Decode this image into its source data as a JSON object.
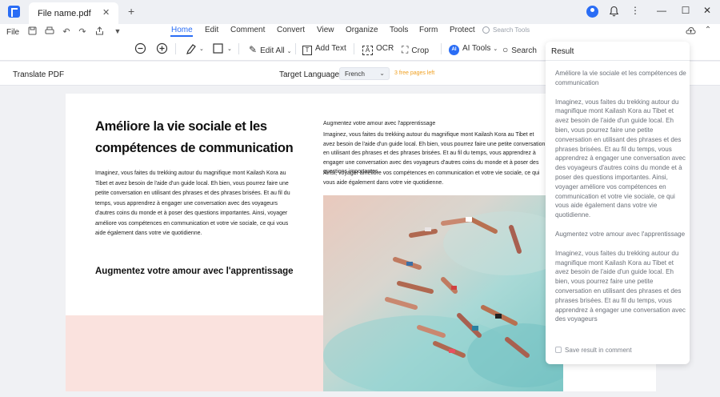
{
  "titlebar": {
    "tab_title": "File name.pdf",
    "tab_close": "✕",
    "new_tab": "+",
    "window_controls": [
      "⋮",
      "—",
      "☐",
      "✕"
    ]
  },
  "toolbar": {
    "file_menu": "File",
    "nav_tabs": [
      "Home",
      "Edit",
      "Comment",
      "Convert",
      "View",
      "Organize",
      "Tools",
      "Form",
      "Protect"
    ],
    "active_tab": "Home",
    "search_tools_placeholder": "Search Tools",
    "tools": {
      "edit_all": "Edit All",
      "add_text": "Add Text",
      "ocr": "OCR",
      "crop": "Crop",
      "ai_tools": "AI Tools",
      "ai_badge": "AI",
      "search": "Search"
    }
  },
  "translate": {
    "title": "Translate PDF",
    "target_language_label": "Target Language",
    "language": "French",
    "free_pages": "3 free pages left"
  },
  "document": {
    "heading": "Améliore la vie sociale et les compétences de communication",
    "body": "Imaginez, vous faites du trekking autour du magnifique mont Kailash Kora au Tibet et avez besoin de l'aide d'un guide local. Eh bien, vous pourrez faire une petite conversation en utilisant des phrases et des phrases brisées. Et au fil du temps, vous apprendrez à engager une conversation avec des voyageurs d'autres coins du monde et à poser des questions importantes. Ainsi, voyager améliore vos compétences en communication et votre vie sociale, ce qui vous aide également dans votre vie quotidienne.",
    "subheading": "Augmentez votre amour avec l'apprentissage",
    "col2_heading": "Augmentez votre amour avec l'apprentissage",
    "col2_p1": "Imaginez, vous faites du trekking autour du magnifique mont Kailash Kora au Tibet et avez besoin de l'aide d'un guide local. Eh bien, vous pourrez faire une petite conversation en utilisant des phrases et des phrases brisées. Et au fil du temps, vous apprendrez à engager une conversation avec des voyageurs d'autres coins du monde et à poser des questions importantes.",
    "col2_p2": "Ainsi, voyager améliore vos compétences en communication et votre vie sociale, ce qui vous aide également dans votre vie quotidienne."
  },
  "result": {
    "title": "Result",
    "paragraphs": [
      "Améliore la vie sociale et les compétences de communication",
      "Imaginez, vous faites du trekking autour du magnifique mont Kailash Kora au Tibet et avez besoin de l'aide d'un guide local. Eh bien, vous pourrez faire une petite conversation en utilisant des phrases et des phrases brisées. Et au fil du temps, vous apprendrez à engager une conversation avec des voyageurs d'autres coins du monde et à poser des questions importantes. Ainsi, voyager améliore vos compétences en communication et votre vie sociale, ce qui vous aide également dans votre vie quotidienne.",
      "Augmentez votre amour avec l'apprentissage",
      "Imaginez, vous faites du trekking autour du magnifique mont Kailash Kora au Tibet et avez besoin de l'aide d'un guide local. Eh bien, vous pourrez faire une petite conversation en utilisant des phrases et des phrases brisées. Et au fil du temps, vous apprendrez à engager une conversation avec des voyageurs"
    ],
    "save_label": "Save result in comment"
  },
  "colors": {
    "accent": "#2a6df5",
    "free_pages": "#f0a020",
    "pink_band": "#fae2de"
  }
}
